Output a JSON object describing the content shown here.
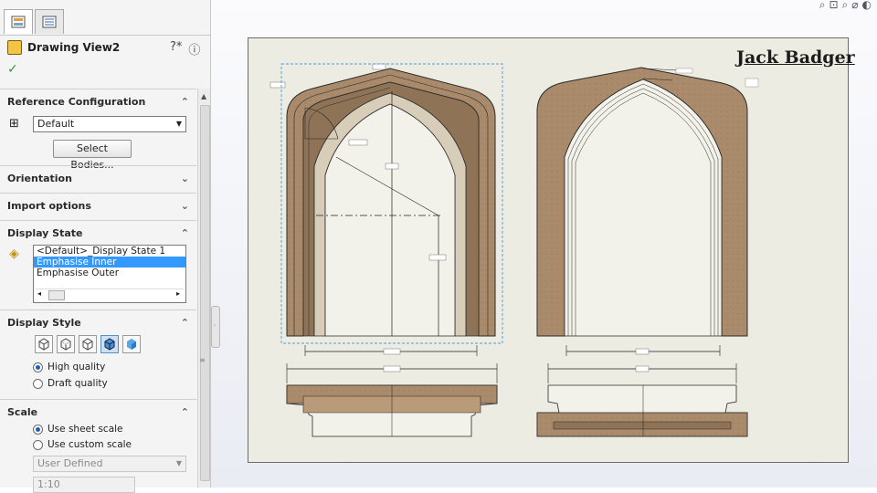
{
  "panel": {
    "tabs": [
      "property-manager",
      "configuration-manager"
    ],
    "title": "Drawing View2",
    "reference_configuration": {
      "label": "Reference Configuration",
      "value": "Default",
      "select_bodies_label": "Select Bodies..."
    },
    "orientation": {
      "label": "Orientation"
    },
    "import_options": {
      "label": "Import options"
    },
    "display_state": {
      "label": "Display State",
      "items": [
        "<Default>_Display State 1",
        "Emphasise Inner",
        "Emphasise Outer"
      ],
      "selected_index": 1
    },
    "display_style": {
      "label": "Display Style",
      "buttons": [
        "wireframe",
        "hidden-lines-visible",
        "hidden-lines-removed",
        "shaded-with-edges",
        "shaded"
      ],
      "active_index": 3,
      "high_quality_label": "High quality",
      "draft_quality_label": "Draft quality",
      "quality_selected": "high"
    },
    "scale": {
      "label": "Scale",
      "use_sheet_scale_label": "Use sheet scale",
      "use_custom_scale_label": "Use custom scale",
      "selected": "sheet",
      "custom_dropdown_value": "User Defined",
      "custom_value": "1:10"
    }
  },
  "sheet": {
    "author": "Jack Badger"
  },
  "colors": {
    "stone": "#a98a6a",
    "stone_dark": "#7b634a",
    "sheet_bg": "#ecece2",
    "selection": "#3399ff"
  }
}
